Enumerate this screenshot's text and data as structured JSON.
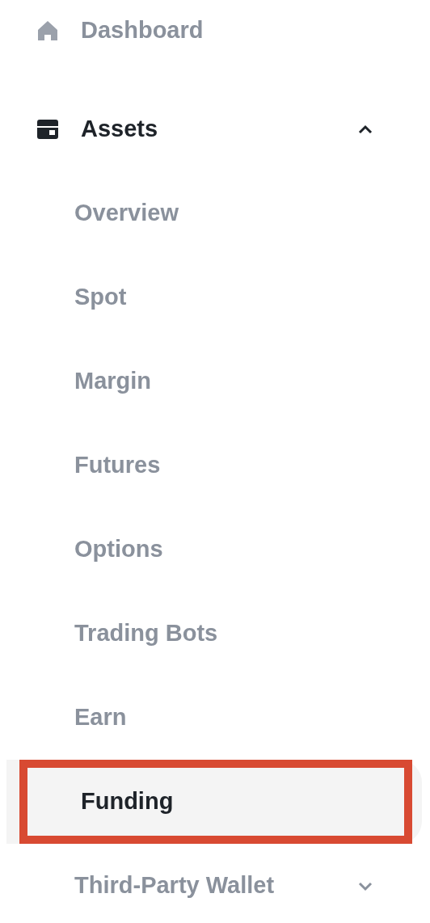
{
  "nav": [
    {
      "label": "Dashboard"
    },
    {
      "label": "Assets",
      "expanded": true,
      "children": [
        {
          "label": "Overview",
          "selected": false
        },
        {
          "label": "Spot",
          "selected": false
        },
        {
          "label": "Margin",
          "selected": false
        },
        {
          "label": "Futures",
          "selected": false
        },
        {
          "label": "Options",
          "selected": false
        },
        {
          "label": "Trading Bots",
          "selected": false
        },
        {
          "label": "Earn",
          "selected": false
        },
        {
          "label": "Funding",
          "selected": true,
          "highlighted": true
        },
        {
          "label": "Third-Party Wallet",
          "selected": false,
          "expanded": false
        }
      ]
    }
  ]
}
